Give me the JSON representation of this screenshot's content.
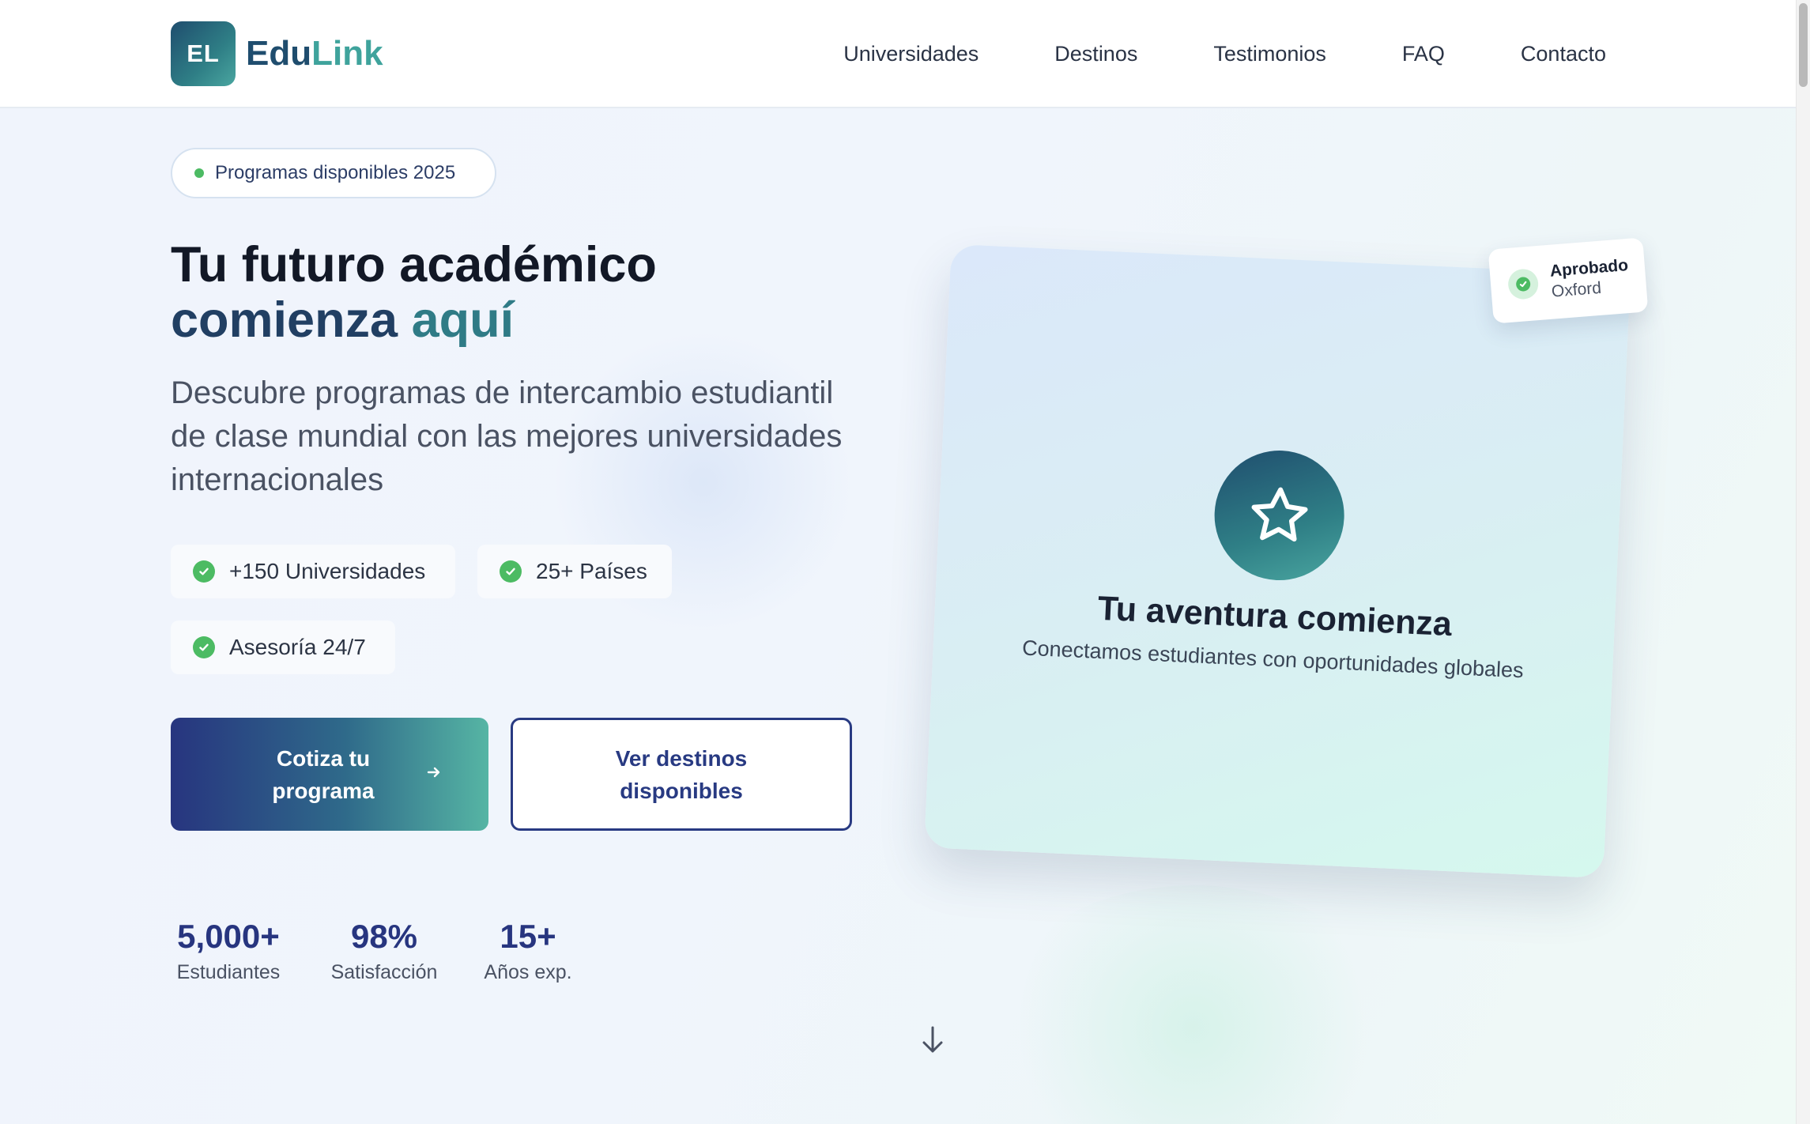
{
  "brand": {
    "mark": "EL",
    "name_part1": "Edu",
    "name_part2": "Link"
  },
  "nav": {
    "items": [
      {
        "label": "Universidades"
      },
      {
        "label": "Destinos"
      },
      {
        "label": "Testimonios"
      },
      {
        "label": "FAQ"
      },
      {
        "label": "Contacto"
      }
    ]
  },
  "hero": {
    "badge": "Programas disponibles 2025",
    "headline_line1": "Tu futuro académico",
    "headline_line2a": "comienza",
    "headline_line2b": "aquí",
    "subtitle": "Descubre programas de intercambio estudiantil de clase mundial con las mejores universidades internacionales",
    "features": [
      {
        "label": "+150 Universidades"
      },
      {
        "label": "25+ Países"
      },
      {
        "label": "Asesoría 24/7"
      }
    ],
    "cta_primary": "Cotiza tu programa",
    "cta_secondary": "Ver destinos disponibles",
    "stats": [
      {
        "value": "5,000+",
        "label": "Estudiantes"
      },
      {
        "value": "98%",
        "label": "Satisfacción"
      },
      {
        "value": "15+",
        "label": "Años exp."
      }
    ]
  },
  "card": {
    "title": "Tu aventura comienza",
    "subtitle": "Conectamos estudiantes con oportunidades globales",
    "icon": "star-icon"
  },
  "approved_badge": {
    "title": "Aprobado",
    "subtitle": "Oxford"
  },
  "colors": {
    "brand_dark": "#1f4d6e",
    "brand_teal": "#3fa39c",
    "primary_navy": "#27357f",
    "success_green": "#4cbb63"
  }
}
